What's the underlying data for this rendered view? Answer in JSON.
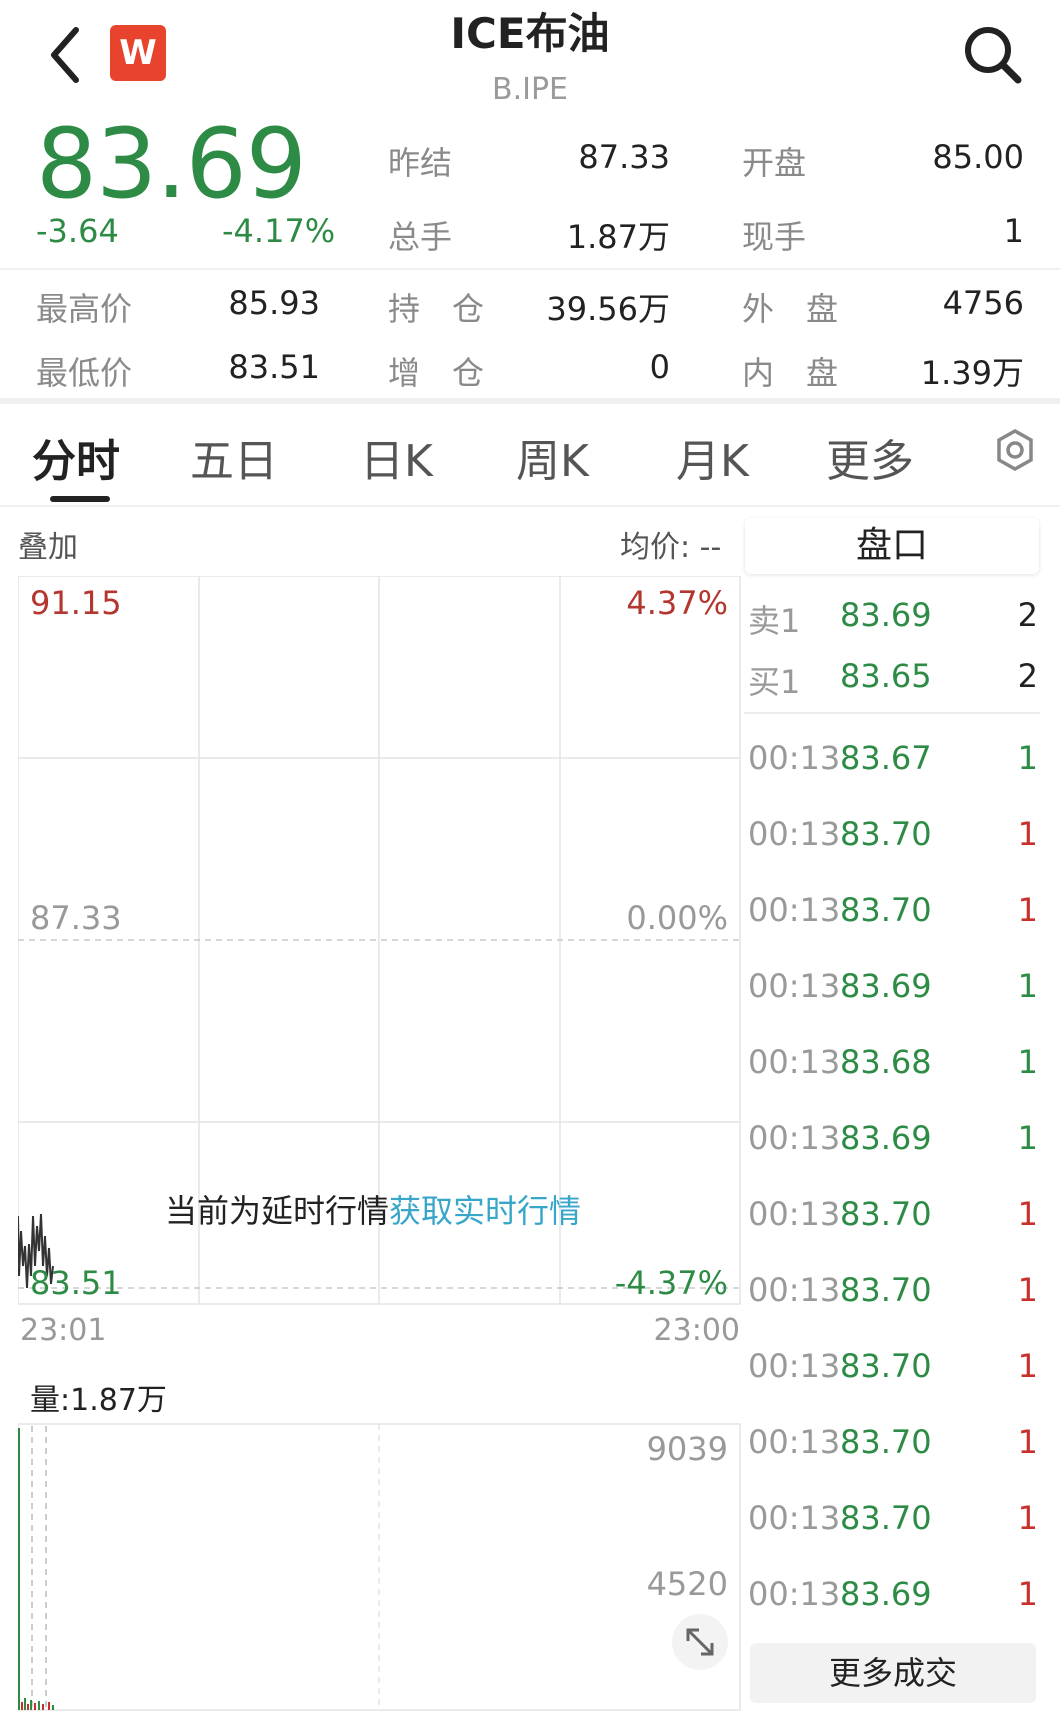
{
  "header": {
    "back_icon": "chevron-left-icon",
    "logo_text": "W",
    "title": "ICE布油",
    "subtitle": "B.IPE",
    "search_icon": "search-icon"
  },
  "quote": {
    "price": "83.69",
    "change": "-3.64",
    "change_pct": "-4.17%",
    "stats": [
      {
        "label": "昨结",
        "value": "87.33"
      },
      {
        "label": "开盘",
        "value": "85.00"
      },
      {
        "label": "总手",
        "value": "1.87万"
      },
      {
        "label": "现手",
        "value": "1"
      },
      {
        "label": "最高价",
        "value": "85.93"
      },
      {
        "label": "持　仓",
        "value": "39.56万"
      },
      {
        "label": "外　盘",
        "value": "4756"
      },
      {
        "label": "最低价",
        "value": "83.51"
      },
      {
        "label": "增　仓",
        "value": "0"
      },
      {
        "label": "内　盘",
        "value": "1.39万"
      }
    ],
    "colors": {
      "down": "#2e8b45",
      "up": "#c9302c"
    }
  },
  "tabs": [
    {
      "label": "分时",
      "active": true
    },
    {
      "label": "五日"
    },
    {
      "label": "日K"
    },
    {
      "label": "周K"
    },
    {
      "label": "月K"
    },
    {
      "label": "更多"
    }
  ],
  "settings_icon": "settings-icon",
  "chart": {
    "overlay_label": "叠加",
    "avg_label": "均价: --",
    "price_top": "91.15",
    "pct_top": "4.37%",
    "price_mid": "87.33",
    "pct_mid": "0.00%",
    "price_bottom": "83.51",
    "pct_bottom": "-4.37%",
    "delay_notice": "当前为延时行情",
    "delay_link": "获取实时行情",
    "time_start": "23:01",
    "time_end": "23:00",
    "volume_label": "量:1.87万",
    "vol_top": "9039",
    "vol_mid": "4520",
    "expand_icon": "expand-icon"
  },
  "chart_data": {
    "type": "line",
    "x": [
      "23:01",
      "23:00"
    ],
    "ylim": [
      83.51,
      91.15
    ],
    "reference": 87.33,
    "pct_range": [
      "-4.37%",
      "4.37%"
    ],
    "volume_ylim": [
      0,
      9039
    ]
  },
  "order_book": {
    "title": "盘口",
    "asks": [
      {
        "label": "卖1",
        "price": "83.69",
        "vol": "2"
      }
    ],
    "bids": [
      {
        "label": "买1",
        "price": "83.65",
        "vol": "2"
      }
    ],
    "trades": [
      {
        "time": "00:13",
        "price": "83.67",
        "vol": "1",
        "dir": "green"
      },
      {
        "time": "00:13",
        "price": "83.70",
        "vol": "1",
        "dir": "red"
      },
      {
        "time": "00:13",
        "price": "83.70",
        "vol": "1",
        "dir": "red"
      },
      {
        "time": "00:13",
        "price": "83.69",
        "vol": "1",
        "dir": "green"
      },
      {
        "time": "00:13",
        "price": "83.68",
        "vol": "1",
        "dir": "green"
      },
      {
        "time": "00:13",
        "price": "83.69",
        "vol": "1",
        "dir": "green"
      },
      {
        "time": "00:13",
        "price": "83.70",
        "vol": "1",
        "dir": "red"
      },
      {
        "time": "00:13",
        "price": "83.70",
        "vol": "1",
        "dir": "red"
      },
      {
        "time": "00:13",
        "price": "83.70",
        "vol": "1",
        "dir": "red"
      },
      {
        "time": "00:13",
        "price": "83.70",
        "vol": "1",
        "dir": "red"
      },
      {
        "time": "00:13",
        "price": "83.70",
        "vol": "1",
        "dir": "red"
      },
      {
        "time": "00:13",
        "price": "83.69",
        "vol": "1",
        "dir": "red"
      }
    ],
    "more_label": "更多成交"
  }
}
